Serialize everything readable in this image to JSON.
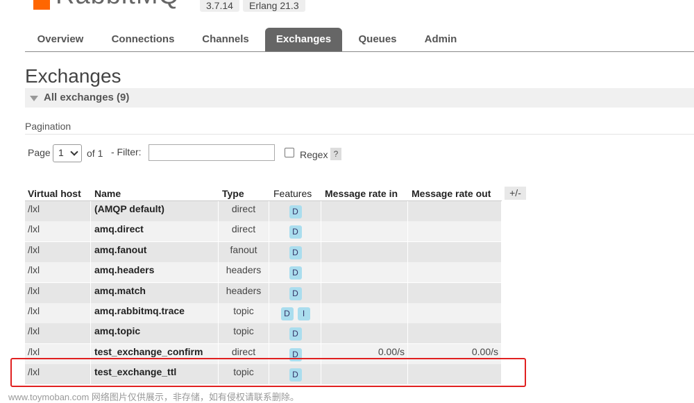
{
  "header": {
    "logo_text": "RabbitMQ",
    "version": "3.7.14",
    "erlang": "Erlang 21.3"
  },
  "tabs": [
    {
      "label": "Overview"
    },
    {
      "label": "Connections"
    },
    {
      "label": "Channels"
    },
    {
      "label": "Exchanges",
      "active": true
    },
    {
      "label": "Queues"
    },
    {
      "label": "Admin"
    }
  ],
  "page": {
    "title": "Exchanges",
    "section_title": "All exchanges (9)"
  },
  "pagination": {
    "label": "Pagination",
    "page_label": "Page",
    "page_value": "1",
    "of_label": "of 1",
    "filter_label": "- Filter:",
    "filter_value": "",
    "regex_label": "Regex",
    "help": "?"
  },
  "table": {
    "columns": [
      "Virtual host",
      "Name",
      "Type",
      "Features",
      "Message rate in",
      "Message rate out"
    ],
    "toggle": "+/-",
    "rows": [
      {
        "vhost": "/lxl",
        "name": "(AMQP default)",
        "type": "direct",
        "features": [
          "D"
        ],
        "rate_in": "",
        "rate_out": ""
      },
      {
        "vhost": "/lxl",
        "name": "amq.direct",
        "type": "direct",
        "features": [
          "D"
        ],
        "rate_in": "",
        "rate_out": ""
      },
      {
        "vhost": "/lxl",
        "name": "amq.fanout",
        "type": "fanout",
        "features": [
          "D"
        ],
        "rate_in": "",
        "rate_out": ""
      },
      {
        "vhost": "/lxl",
        "name": "amq.headers",
        "type": "headers",
        "features": [
          "D"
        ],
        "rate_in": "",
        "rate_out": ""
      },
      {
        "vhost": "/lxl",
        "name": "amq.match",
        "type": "headers",
        "features": [
          "D"
        ],
        "rate_in": "",
        "rate_out": ""
      },
      {
        "vhost": "/lxl",
        "name": "amq.rabbitmq.trace",
        "type": "topic",
        "features": [
          "D",
          "I"
        ],
        "rate_in": "",
        "rate_out": ""
      },
      {
        "vhost": "/lxl",
        "name": "amq.topic",
        "type": "topic",
        "features": [
          "D"
        ],
        "rate_in": "",
        "rate_out": ""
      },
      {
        "vhost": "/lxl",
        "name": "test_exchange_confirm",
        "type": "direct",
        "features": [
          "D"
        ],
        "rate_in": "0.00/s",
        "rate_out": "0.00/s"
      },
      {
        "vhost": "/lxl",
        "name": "test_exchange_ttl",
        "type": "topic",
        "features": [
          "D"
        ],
        "rate_in": "",
        "rate_out": ""
      }
    ]
  },
  "watermark": "www.toymoban.com 网络图片仅供展示，非存储，如有侵权请联系删除。",
  "colors": {
    "active_tab": "#666666",
    "badge": "#aaddee",
    "highlight": "#e02020",
    "logo": "#ff6600"
  }
}
